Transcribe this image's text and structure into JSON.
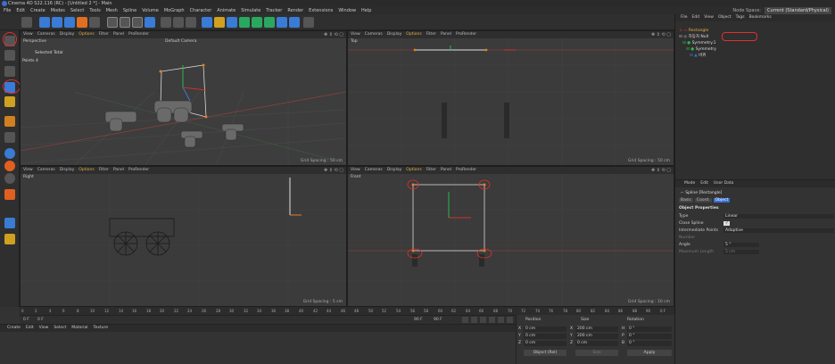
{
  "window": {
    "title": "Cinema 4D S22.116 (RC) - [Untitled 2 *] - Main"
  },
  "menubar": {
    "items": [
      "File",
      "Edit",
      "Create",
      "Modes",
      "Select",
      "Tools",
      "Mesh",
      "Spline",
      "Volume",
      "MoGraph",
      "Character",
      "Animate",
      "Simulate",
      "Tracker",
      "Render",
      "Extensions",
      "Window",
      "Help"
    ],
    "node_space_label": "Node Space:",
    "node_space_value": "Current (Standard/Physical)"
  },
  "viewport_menu": {
    "items": [
      "View",
      "Cameras",
      "Display",
      "Options",
      "Filter",
      "Panel",
      "ProRender"
    ]
  },
  "viewports": {
    "perspective": {
      "name": "Perspective",
      "camera": "Default Camera",
      "hud_title": "Selected Total",
      "hud_points_label": "Points",
      "hud_points_value": "4",
      "grid": "Grid Spacing : 50 cm"
    },
    "top": {
      "name": "Top",
      "grid": "Grid Spacing : 50 cm"
    },
    "right": {
      "name": "Right",
      "grid": "Grid Spacing : 5 cm"
    },
    "front": {
      "name": "Front",
      "grid": "Grid Spacing : 10 cm"
    }
  },
  "object_manager": {
    "menu": [
      "File",
      "Edit",
      "View",
      "Object",
      "Tags",
      "Bookmarks"
    ],
    "objects": [
      {
        "name": "Rectangle",
        "selected": true
      },
      {
        "name": "자동차 Null"
      },
      {
        "name": "Symmetry.1"
      },
      {
        "name": "Symmetry"
      },
      {
        "name": "바퀴"
      }
    ]
  },
  "attributes": {
    "menu": [
      "Mode",
      "Edit",
      "User Data"
    ],
    "object_title": "Spline [Rectangle]",
    "tabs": [
      "Basic",
      "Coord.",
      "Object"
    ],
    "active_tab": "Object",
    "section": "Object Properties",
    "props": [
      {
        "label": "Type",
        "value": "Linear"
      },
      {
        "label": "Close Spline",
        "value": "✓"
      },
      {
        "label": "Intermediate Points",
        "value": "Adaptive"
      },
      {
        "label": "Number",
        "value": "",
        "dim": true
      },
      {
        "label": "Angle",
        "value": "5 °"
      },
      {
        "label": "Maximum Length",
        "value": "5 cm",
        "dim": true
      }
    ]
  },
  "timeline": {
    "ticks": [
      "0",
      "2",
      "4",
      "6",
      "8",
      "10",
      "12",
      "14",
      "16",
      "18",
      "20",
      "22",
      "24",
      "26",
      "28",
      "30",
      "32",
      "34",
      "36",
      "38",
      "40",
      "42",
      "44",
      "46",
      "48",
      "50",
      "52",
      "54",
      "56",
      "58",
      "60",
      "62",
      "64",
      "66",
      "68",
      "70",
      "72",
      "74",
      "76",
      "78",
      "80",
      "82",
      "84",
      "86",
      "88",
      "90"
    ],
    "end_frame": "0 F"
  },
  "playback": {
    "current": "0 F",
    "start": "0 F",
    "end": "90 F",
    "max": "90 F"
  },
  "material_manager": {
    "menu": [
      "Create",
      "Edit",
      "View",
      "Select",
      "Material",
      "Texture"
    ]
  },
  "coordinates": {
    "headers": [
      "Position",
      "Size",
      "Rotation"
    ],
    "rows": [
      {
        "axis": "X",
        "pos": "0 cm",
        "size_axis": "X",
        "size": "200 cm",
        "rot_axis": "H",
        "rot": "0 °"
      },
      {
        "axis": "Y",
        "pos": "0 cm",
        "size_axis": "Y",
        "size": "200 cm",
        "rot_axis": "P",
        "rot": "0 °"
      },
      {
        "axis": "Z",
        "pos": "0 cm",
        "size_axis": "Z",
        "size": "0 cm",
        "rot_axis": "B",
        "rot": "0 °"
      }
    ],
    "mode": "Object (Rel)",
    "size_mode": "Size",
    "apply": "Apply"
  },
  "colors": {
    "accent": "#3a6fd1",
    "highlight": "#e03030",
    "selected_text": "#e8b040",
    "bg": "#333333"
  }
}
